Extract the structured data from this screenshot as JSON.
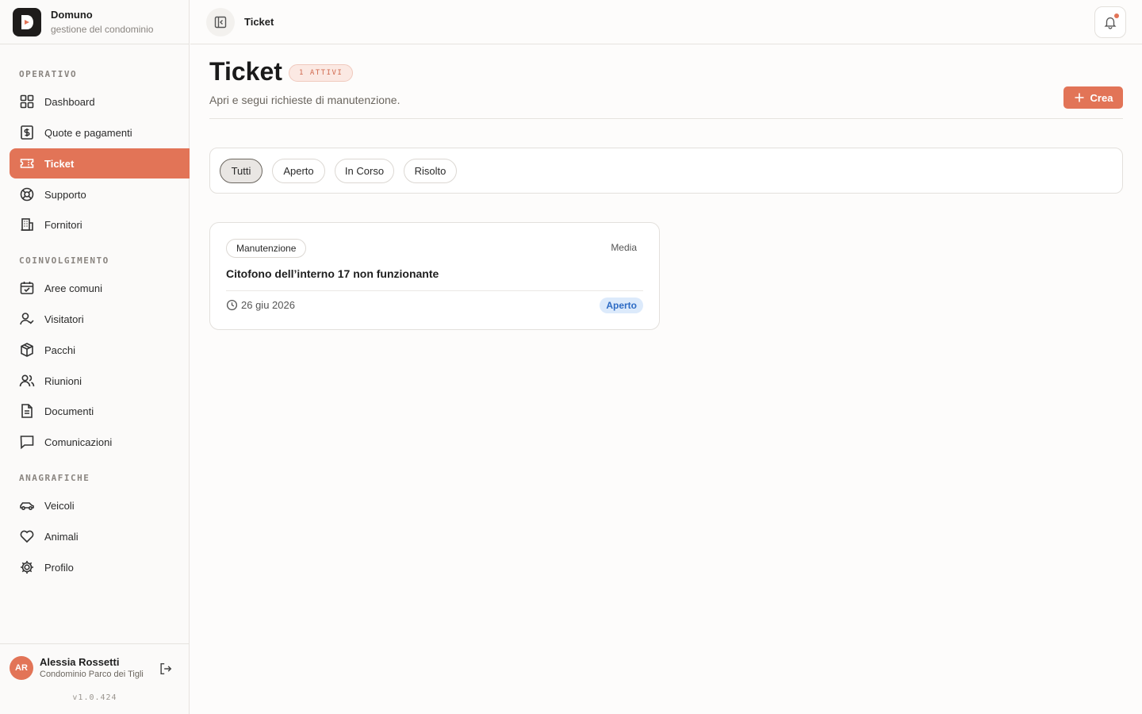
{
  "app": {
    "name": "Domuno",
    "tagline": "gestione del condominio",
    "accent_color": "#e27457"
  },
  "sidebar": {
    "sections": [
      {
        "label": "OPERATIVO",
        "items": [
          {
            "label": "Dashboard",
            "icon": "dashboard-icon",
            "active": false
          },
          {
            "label": "Quote e pagamenti",
            "icon": "receipt-dollar-icon",
            "active": false
          },
          {
            "label": "Ticket",
            "icon": "ticket-icon",
            "active": true
          },
          {
            "label": "Supporto",
            "icon": "lifebuoy-icon",
            "active": false
          },
          {
            "label": "Fornitori",
            "icon": "building-icon",
            "active": false
          }
        ]
      },
      {
        "label": "COINVOLGIMENTO",
        "items": [
          {
            "label": "Aree comuni",
            "icon": "calendar-check-icon",
            "active": false
          },
          {
            "label": "Visitatori",
            "icon": "user-check-icon",
            "active": false
          },
          {
            "label": "Pacchi",
            "icon": "package-icon",
            "active": false
          },
          {
            "label": "Riunioni",
            "icon": "users-icon",
            "active": false
          },
          {
            "label": "Documenti",
            "icon": "document-icon",
            "active": false
          },
          {
            "label": "Comunicazioni",
            "icon": "message-icon",
            "active": false
          }
        ]
      },
      {
        "label": "ANAGRAFICHE",
        "items": [
          {
            "label": "Veicoli",
            "icon": "car-icon",
            "active": false
          },
          {
            "label": "Animali",
            "icon": "heart-icon",
            "active": false
          },
          {
            "label": "Profilo",
            "icon": "gear-icon",
            "active": false
          }
        ]
      }
    ],
    "user": {
      "initials": "AR",
      "name": "Alessia Rossetti",
      "org": "Condominio Parco dei Tigli"
    },
    "version": "v1.0.424"
  },
  "topbar": {
    "breadcrumb": "Ticket",
    "has_notification": true
  },
  "main": {
    "title": "Ticket",
    "count_badge": "1 ATTIVI",
    "subtitle": "Apri e segui richieste di manutenzione.",
    "create_label": "Crea",
    "filters": [
      {
        "label": "Tutti",
        "active": true
      },
      {
        "label": "Aperto",
        "active": false
      },
      {
        "label": "In Corso",
        "active": false
      },
      {
        "label": "Risolto",
        "active": false
      }
    ],
    "tickets": [
      {
        "category": "Manutenzione",
        "priority": "Media",
        "title": "Citofono dell’interno 17 non funzionante",
        "date": "26 giu 2026",
        "status": "Aperto",
        "status_color": "#2d6bc4"
      }
    ]
  }
}
